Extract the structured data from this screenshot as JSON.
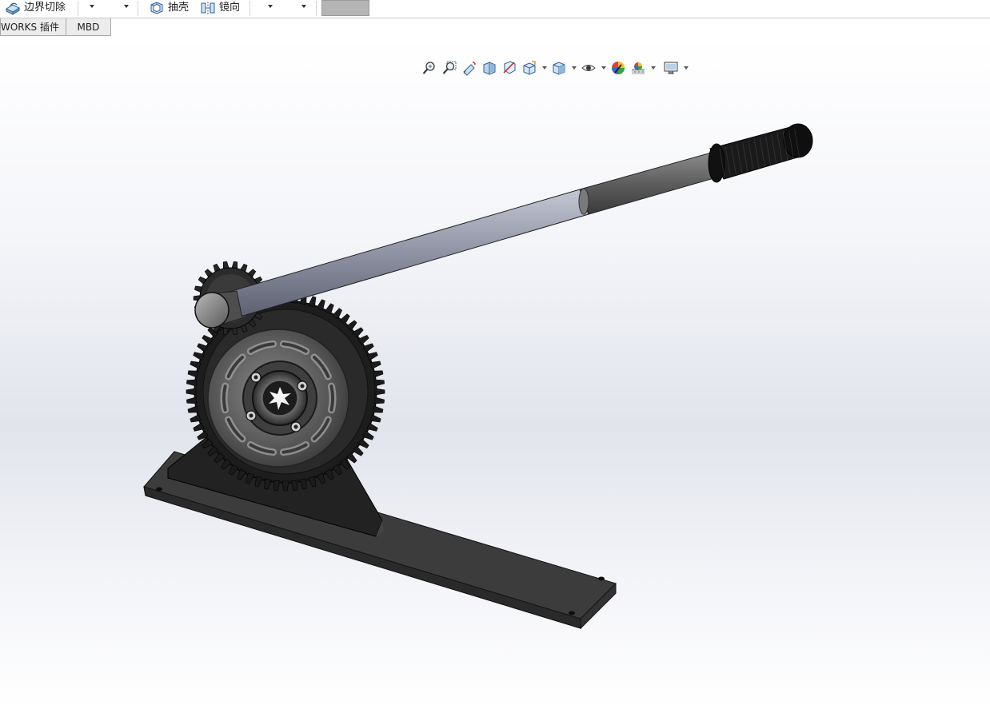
{
  "toolbar": {
    "boundary_cut_label": "边界切除",
    "shell_label": "抽壳",
    "mirror_label": "镜向"
  },
  "tabs": [
    {
      "label": "WORKS 插件"
    },
    {
      "label": "MBD"
    }
  ],
  "heads_up_toolbar": {
    "icons": [
      "zoom-to-fit-icon",
      "zoom-to-area-icon",
      "previous-view-icon",
      "section-view-icon",
      "dynamic-annotation-icon",
      "view-orientation-icon",
      "display-style-icon",
      "hide-show-items-icon",
      "edit-appearance-icon",
      "apply-scene-icon",
      "view-settings-icon"
    ]
  },
  "model": {
    "description_colors": {
      "base_plate": "#3a3a3a",
      "gear": "#1e1e1e",
      "handle_bar": "#8a8e9c",
      "grip": "#151515",
      "disc": "#5c5c5c"
    }
  }
}
